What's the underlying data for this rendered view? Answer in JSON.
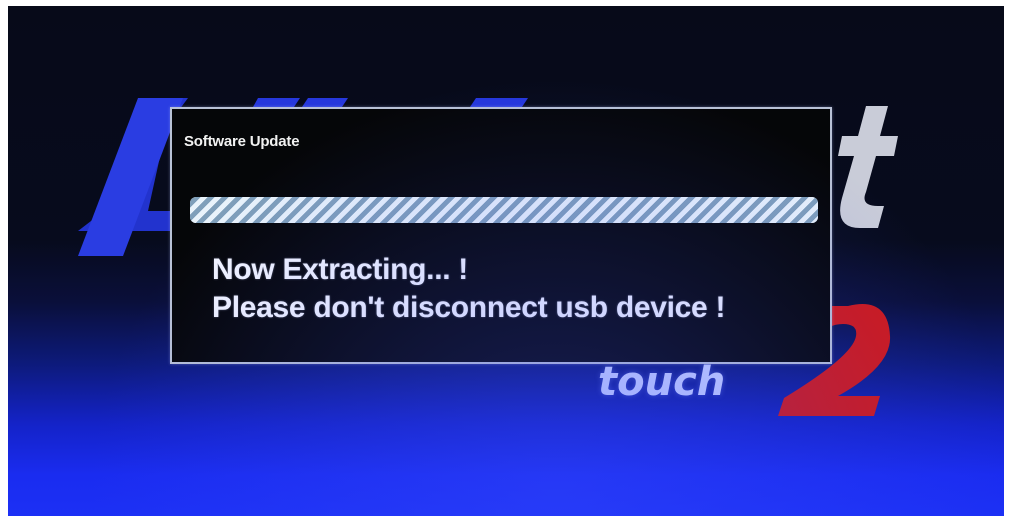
{
  "background": {
    "brand_mark_text": "touch",
    "brand_mark_number": "2",
    "colors": {
      "screen_top": "#070a19",
      "screen_bottom": "#1c30f5",
      "logo_blue": "#2a3dd8",
      "logo_red": "#d01818"
    }
  },
  "dialog": {
    "title": "Software Update",
    "progress": {
      "state": "indeterminate",
      "fraction": 1.0
    },
    "messages": [
      "Now Extracting... !",
      "Please don't disconnect usb device !"
    ],
    "colors": {
      "background": "#050608",
      "border": "#b9c2d6",
      "text": "#f4f6ff",
      "progress_light": "#e9f3fb",
      "progress_stripe": "#7f9fba"
    }
  }
}
